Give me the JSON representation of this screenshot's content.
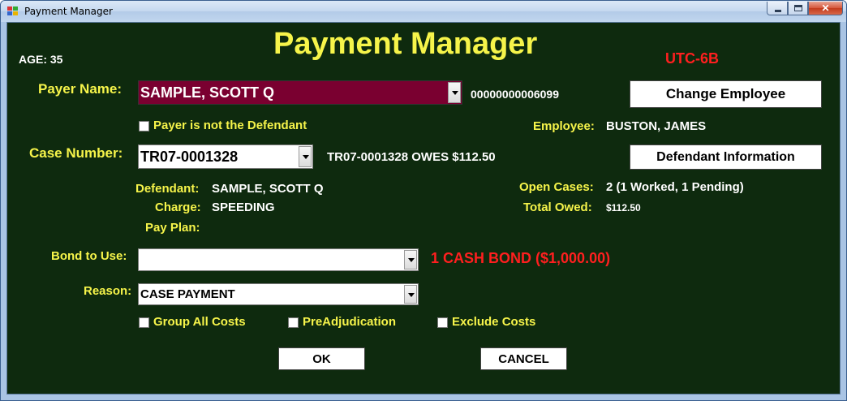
{
  "window": {
    "title": "Payment Manager"
  },
  "header": {
    "title": "Payment Manager",
    "age_label": "AGE: 35",
    "timezone": "UTC-6B"
  },
  "payer": {
    "label": "Payer Name:",
    "value": "SAMPLE, SCOTT Q",
    "account": "00000000006099",
    "not_defendant_label": "Payer is not the Defendant"
  },
  "employee": {
    "change_button": "Change Employee",
    "label": "Employee:",
    "value": "BUSTON, JAMES"
  },
  "case": {
    "label": "Case Number:",
    "value": "TR07-0001328",
    "owes_text": "TR07-0001328 OWES $112.50",
    "defendant_button": "Defendant Information"
  },
  "details": {
    "defendant_label": "Defendant:",
    "defendant_value": "SAMPLE, SCOTT Q",
    "charge_label": "Charge:",
    "charge_value": "SPEEDING",
    "payplan_label": "Pay Plan:",
    "open_cases_label": "Open Cases:",
    "open_cases_value": "2 (1 Worked, 1 Pending)",
    "total_owed_label": "Total Owed:",
    "total_owed_value": "$112.50"
  },
  "bond": {
    "label": "Bond to Use:",
    "value": "",
    "info": "1 CASH BOND ($1,000.00)"
  },
  "reason": {
    "label": "Reason:",
    "value": "CASE PAYMENT"
  },
  "options": {
    "group_all_costs": "Group All Costs",
    "preadjudication": "PreAdjudication",
    "exclude_costs": "Exclude Costs"
  },
  "buttons": {
    "ok": "OK",
    "cancel": "CANCEL"
  },
  "colors": {
    "background": "#0e2a0e",
    "label": "#f6f44a",
    "alert": "#ff1f1f",
    "payer_field": "#7a0030"
  }
}
